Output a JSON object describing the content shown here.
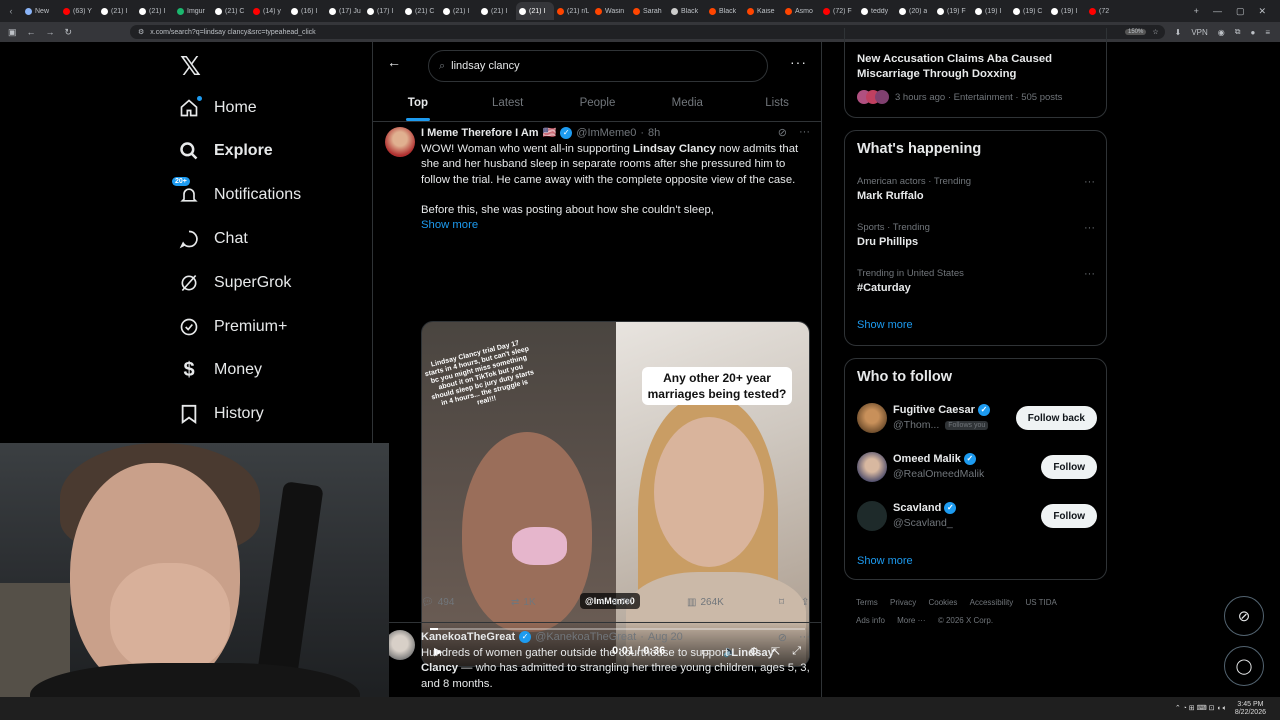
{
  "browser": {
    "tabs": [
      "New",
      "(63) Y",
      "(21) I",
      "(21) I",
      "Imgur",
      "(21) C",
      "(14) y",
      "(16) I",
      "(17) Ju",
      "(17) I",
      "(21) C",
      "(21) I",
      "(21) I",
      "(21) I",
      "(21) r/Live",
      "Wasin",
      "Sarah",
      "Black",
      "Black",
      "Kaise",
      "Asmo",
      "(72) F",
      "teddy",
      "(20) a",
      "(19) F",
      "(19) I",
      "(19) C",
      "(19) I",
      "(72"
    ],
    "tab_colors": [
      "#8ab4f8",
      "#ff0000",
      "#ffffff",
      "#ffffff",
      "#1bb76e",
      "#ffffff",
      "#ff0000",
      "#ffffff",
      "#ffffff",
      "#ffffff",
      "#ffffff",
      "#ffffff",
      "#ffffff",
      "#ffffff",
      "#ff4500",
      "#ff4500",
      "#ff4500",
      "#cccccc",
      "#ff4500",
      "#ff4500",
      "#ff4500",
      "#ff0000",
      "#ffffff",
      "#ffffff",
      "#ffffff",
      "#ffffff",
      "#ffffff",
      "#ffffff",
      "#ff0000"
    ],
    "active_tab": 13,
    "url": "x.com/search?q=lindsay clancy&src=typeahead_click",
    "zoom": "150%",
    "vpn": "VPN"
  },
  "sidebar": {
    "items": [
      {
        "label": "Home",
        "icon": "home-icon"
      },
      {
        "label": "Explore",
        "icon": "search-icon"
      },
      {
        "label": "Notifications",
        "icon": "bell-icon",
        "badge": "20+"
      },
      {
        "label": "Chat",
        "icon": "chat-icon"
      },
      {
        "label": "SuperGrok",
        "icon": "grok-icon"
      },
      {
        "label": "Premium+",
        "icon": "premium-icon"
      },
      {
        "label": "Money",
        "icon": "money-icon"
      },
      {
        "label": "History",
        "icon": "bookmark-icon"
      }
    ]
  },
  "search": {
    "value": "lindsay clancy",
    "tabs": [
      "Top",
      "Latest",
      "People",
      "Media",
      "Lists"
    ]
  },
  "tweet1": {
    "name": "I Meme Therefore I Am",
    "flag": "🇺🇸",
    "handle": "@ImMeme0",
    "time": "8h",
    "text_a": "WOW! Woman who went all-in supporting ",
    "text_bold": "Lindsay Clancy",
    "text_b": " now admits that she and her husband sleep in separate rooms after she pressured him to follow the trial. He came away with the complete opposite view of the case.",
    "text_2": "Before this, she was posting about how she couldn't sleep,",
    "show_more": "Show more",
    "overlay_left": "Lindsay Clancy trial Day 17 starts in 4 hours, but can't sleep bc you might miss something about it on TikTok but you should sleep bc jury duty starts in 4 hours... the struggle is real!!!",
    "overlay_right": "Any other 20+ year marriages being tested?",
    "watermark": "@ImMeme0",
    "video_time": "0:01 / 0:36",
    "progress": 0.02,
    "replies": "494",
    "reposts": "1K",
    "likes": "8.7K",
    "views": "264K"
  },
  "tweet2": {
    "name": "KanekoaTheGreat",
    "handle": "@KanekoaTheGreat",
    "time": "Aug 20",
    "text_a": "Hundreds of women gather outside the courthouse to support ",
    "text_bold": "Lindsay Clancy",
    "text_b": " — who has admitted to strangling her three young children, ages 5, 3, and 8 months."
  },
  "right": {
    "top_title": "New Accusation Claims Aba Caused Miscarriage Through Doxxing",
    "top_meta": "3 hours ago · Entertainment · 505 posts",
    "happening_title": "What's happening",
    "trends": [
      {
        "category": "American actors · Trending",
        "title": "Mark Ruffalo"
      },
      {
        "category": "Sports · Trending",
        "title": "Dru Phillips"
      },
      {
        "category": "Trending in United States",
        "title": "#Caturday"
      }
    ],
    "show_more": "Show more",
    "wtf_title": "Who to follow",
    "follow": [
      {
        "name": "Fugitive Caesar",
        "handle": "@Thom...",
        "follows_you": "Follows you",
        "button": "Follow back",
        "color": "#8a6a3a"
      },
      {
        "name": "Omeed Malik",
        "handle": "@RealOmeedMalik",
        "follows_you": "",
        "button": "Follow",
        "color": "#6a5a7a"
      },
      {
        "name": "Scavland",
        "handle": "@Scavland_",
        "follows_you": "",
        "button": "Follow",
        "color": "#2e3a3a"
      }
    ],
    "footer": [
      "Terms",
      "Privacy",
      "Cookies",
      "Accessibility",
      "US TIDA",
      "Ads info",
      "More ···",
      "© 2026 X Corp."
    ]
  },
  "taskbar": {
    "time": "3:45 PM",
    "date": "8/22/2026"
  }
}
